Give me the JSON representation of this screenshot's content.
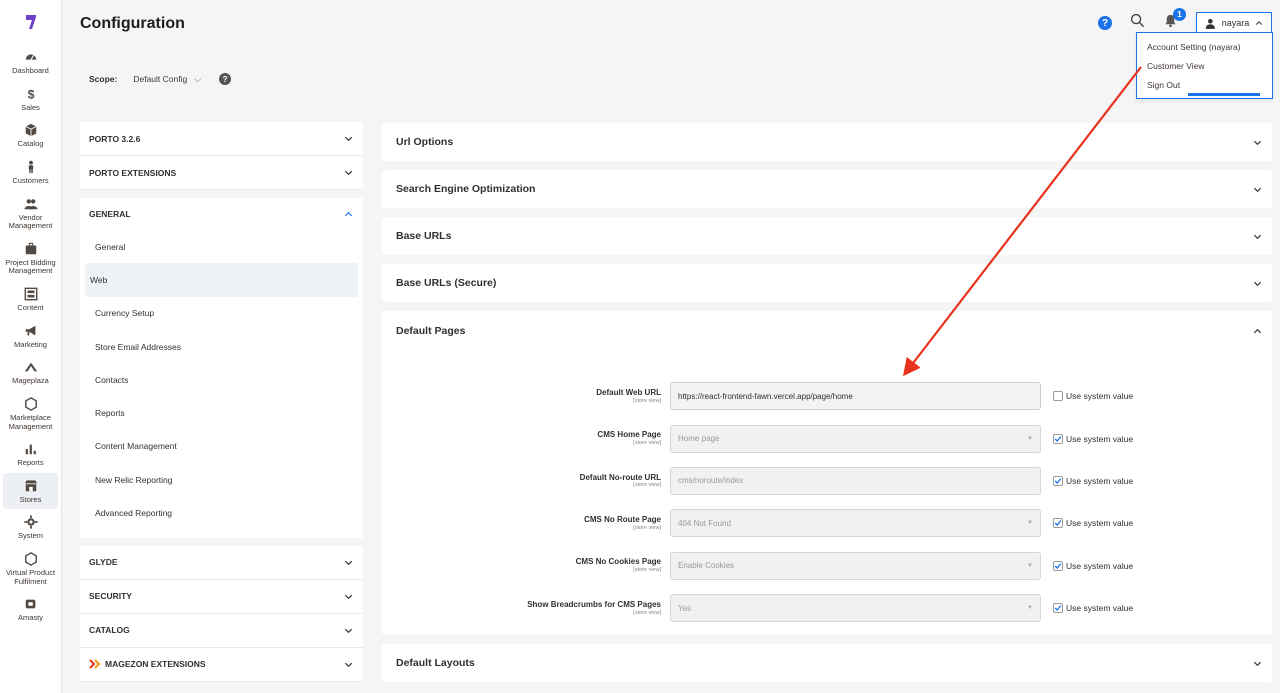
{
  "header": {
    "title": "Configuration",
    "notifications_count": "1",
    "user_name": "nayara"
  },
  "user_menu": {
    "items": [
      "Account Setting (nayara)",
      "Customer View",
      "Sign Out"
    ]
  },
  "scope": {
    "label": "Scope:",
    "value": "Default Config"
  },
  "sidebar": {
    "items": [
      {
        "label": "Dashboard",
        "icon": "dashboard-icon"
      },
      {
        "label": "Sales",
        "icon": "dollar-icon"
      },
      {
        "label": "Catalog",
        "icon": "box-icon"
      },
      {
        "label": "Customers",
        "icon": "person-icon"
      },
      {
        "label": "Vendor Management",
        "icon": "users-icon"
      },
      {
        "label": "Project Bidding Management",
        "icon": "briefcase-icon"
      },
      {
        "label": "Content",
        "icon": "layout-icon"
      },
      {
        "label": "Marketing",
        "icon": "megaphone-icon"
      },
      {
        "label": "Mageplaza",
        "icon": "mageplaza-icon"
      },
      {
        "label": "Marketplace Management",
        "icon": "hexagon-icon"
      },
      {
        "label": "Reports",
        "icon": "bar-chart-icon"
      },
      {
        "label": "Stores",
        "icon": "store-icon"
      },
      {
        "label": "System",
        "icon": "gear-icon"
      },
      {
        "label": "Virtual Product Fulfilment",
        "icon": "hexagon-icon"
      },
      {
        "label": "Amasty",
        "icon": "amasty-icon"
      }
    ]
  },
  "config_tabs": {
    "top_sections": [
      "PORTO 3.2.6",
      "PORTO EXTENSIONS"
    ],
    "general": {
      "title": "GENERAL",
      "items": [
        "General",
        "Web",
        "Currency Setup",
        "Store Email Addresses",
        "Contacts",
        "Reports",
        "Content Management",
        "New Relic Reporting",
        "Advanced Reporting"
      ],
      "active": "Web"
    },
    "bottom_sections": [
      "GLYDE",
      "SECURITY",
      "CATALOG",
      "MAGEZON EXTENSIONS"
    ]
  },
  "groups": {
    "collapsed_top": [
      "Url Options",
      "Search Engine Optimization",
      "Base URLs",
      "Base URLs (Secure)"
    ],
    "default_pages": {
      "title": "Default Pages",
      "rows": [
        {
          "label": "Default Web URL",
          "scope": "[store view]",
          "value": "https://react-frontend-fawn.vercel.app/page/home",
          "type": "text",
          "use_system": false
        },
        {
          "label": "CMS Home Page",
          "scope": "[store view]",
          "value": "Home page",
          "type": "select",
          "use_system": true
        },
        {
          "label": "Default No-route URL",
          "scope": "[store view]",
          "value": "cms/noroute/index",
          "type": "text",
          "use_system": true
        },
        {
          "label": "CMS No Route Page",
          "scope": "[store view]",
          "value": "404 Not Found",
          "type": "select",
          "use_system": true
        },
        {
          "label": "CMS No Cookies Page",
          "scope": "[store view]",
          "value": "Enable Cookies",
          "type": "select",
          "use_system": true
        },
        {
          "label": "Show Breadcrumbs for CMS Pages",
          "scope": "[store view]",
          "value": "Yes",
          "type": "select",
          "use_system": true
        }
      ],
      "use_system_label": "Use system value"
    },
    "collapsed_bottom": [
      "Default Layouts"
    ]
  },
  "colors": {
    "accent": "#1a73e8",
    "annotation_arrow": "#e8321c"
  }
}
